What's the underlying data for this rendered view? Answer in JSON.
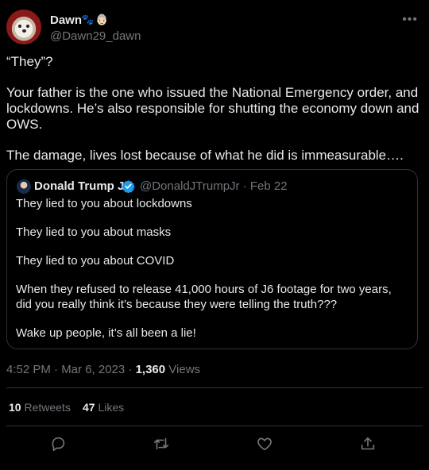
{
  "author": {
    "display_name": "Dawn",
    "emoji_1": "🐾",
    "emoji_2": "👵🏻",
    "handle": "@Dawn29_dawn"
  },
  "tweet": {
    "paragraphs": [
      "“They”?",
      "Your father is the one who issued the National Emergency order, and lockdowns. He’s also responsible for shutting the economy down and OWS.",
      "The damage, lives lost because of what he did is immeasurable…."
    ]
  },
  "quote": {
    "display_name": "Donald Trump Jr.",
    "handle_date": "@DonaldJTrumpJr · Feb 22",
    "paragraphs": [
      "They lied to you about lockdowns",
      "They lied to you about masks",
      "They lied to you about COVID",
      "When they refused to release 41,000 hours of J6 footage for two years, did you really think it’s because they were telling the truth???",
      "Wake up people, it’s all been a lie!"
    ]
  },
  "meta": {
    "timestamp": "4:52 PM · Mar 6, 2023 · ",
    "views_count": "1,360",
    "views_label": " Views"
  },
  "stats": {
    "retweets_count": "10",
    "retweets_label": " Retweets",
    "likes_count": "47",
    "likes_label": " Likes"
  },
  "actions": [
    "reply-icon",
    "retweet-icon",
    "like-icon",
    "share-icon"
  ],
  "colors": {
    "background": "#000000",
    "text": "#e7e9ea",
    "muted": "#71767b",
    "border": "#2f3336",
    "verified": "#1d9bf0"
  }
}
